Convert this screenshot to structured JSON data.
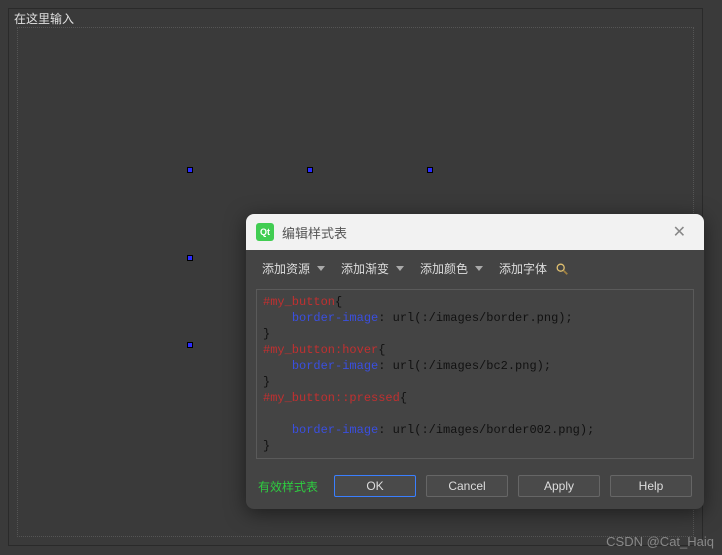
{
  "canvas": {
    "input_label": "在这里输入"
  },
  "dialog": {
    "title": "编辑样式表",
    "toolbar": {
      "add_resource": "添加资源",
      "add_gradient": "添加渐变",
      "add_color": "添加颜色",
      "add_font": "添加字体"
    },
    "code": {
      "line1_sel": "#my_button",
      "line1_brace": "{",
      "line2_prop": "border-image",
      "line2_rest": ": url(:/images/border.png);",
      "line3_brace": "}",
      "line4_sel": "#my_button",
      "line4_pseudo": ":hover",
      "line4_brace": "{",
      "line5_prop": "border-image",
      "line5_rest": ": url(:/images/bc2.png);",
      "line6_brace": "}",
      "line7_sel": "#my_button",
      "line7_pseudo": "::pressed",
      "line7_brace": "{",
      "line8_blank": "",
      "line9_prop": "border-image",
      "line9_rest": ": url(:/images/border002.png);",
      "line10_brace": "}"
    },
    "valid_label": "有效样式表",
    "buttons": {
      "ok": "OK",
      "cancel": "Cancel",
      "apply": "Apply",
      "help": "Help"
    }
  },
  "watermark": "CSDN @Cat_Haiq"
}
